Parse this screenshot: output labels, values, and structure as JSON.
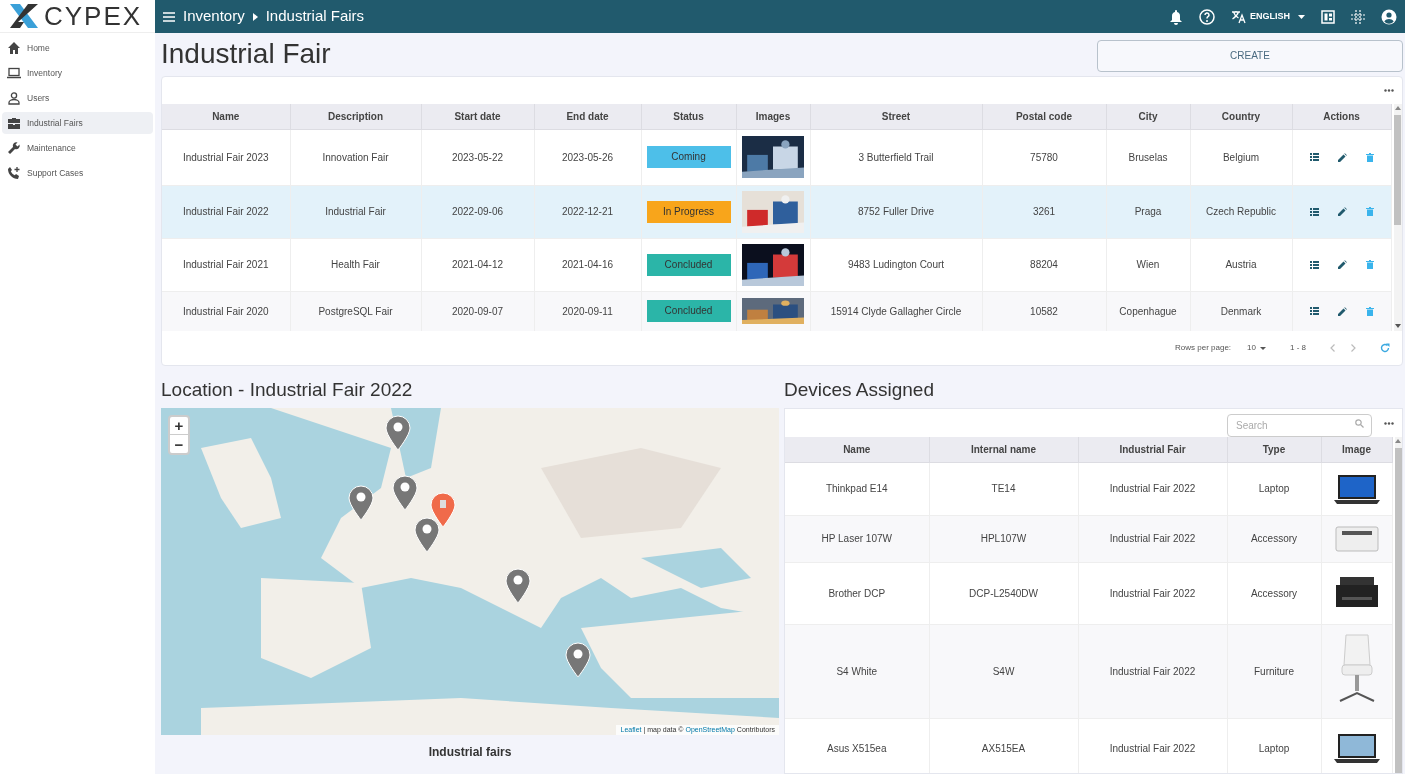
{
  "logo": {
    "text": "CYPEX"
  },
  "breadcrumb": [
    "Inventory",
    "Industrial Fairs"
  ],
  "topbar": {
    "language": "ENGLISH"
  },
  "sidebar": {
    "items": [
      {
        "label": "Home",
        "selected": false
      },
      {
        "label": "Inventory",
        "selected": false
      },
      {
        "label": "Users",
        "selected": false
      },
      {
        "label": "Industrial Fairs",
        "selected": true
      },
      {
        "label": "Maintenance",
        "selected": false
      },
      {
        "label": "Support Cases",
        "selected": false
      }
    ]
  },
  "page_title": "Industrial Fair",
  "create_button": "CREATE",
  "fairs_table": {
    "columns": [
      "Name",
      "Description",
      "Start date",
      "End date",
      "Status",
      "Images",
      "Street",
      "Postal code",
      "City",
      "Country",
      "Actions"
    ],
    "rows": [
      {
        "name": "Industrial Fair 2023",
        "description": "Innovation Fair",
        "start": "2023-05-22",
        "end": "2023-05-26",
        "status": {
          "text": "Coming",
          "color": "#4dbfe9"
        },
        "street": "3 Butterfield Trail",
        "postal": "75780",
        "city": "Bruselas",
        "country": "Belgium",
        "selected": false
      },
      {
        "name": "Industrial Fair 2022",
        "description": "Industrial Fair",
        "start": "2022-09-06",
        "end": "2022-12-21",
        "status": {
          "text": "In Progress",
          "color": "#f8a51b"
        },
        "street": "8752 Fuller Drive",
        "postal": "3261",
        "city": "Praga",
        "country": "Czech Republic",
        "selected": true
      },
      {
        "name": "Industrial Fair 2021",
        "description": "Health Fair",
        "start": "2021-04-12",
        "end": "2021-04-16",
        "status": {
          "text": "Concluded",
          "color": "#2bb5a8"
        },
        "street": "9483 Ludington Court",
        "postal": "88204",
        "city": "Wien",
        "country": "Austria",
        "selected": false
      },
      {
        "name": "Industrial Fair 2020",
        "description": "PostgreSQL Fair",
        "start": "2020-09-07",
        "end": "2020-09-11",
        "status": {
          "text": "Concluded",
          "color": "#2bb5a8"
        },
        "street": "15914 Clyde Gallagher Circle",
        "postal": "10582",
        "city": "Copenhague",
        "country": "Denmark",
        "selected": false
      }
    ],
    "pagination": {
      "rows_per_page_label": "Rows per page:",
      "rows_per_page": "10",
      "range": "1 - 8"
    }
  },
  "location": {
    "title": "Location - Industrial Fair 2022",
    "zoom_in": "+",
    "zoom_out": "−",
    "markers": [
      {
        "selected": false
      },
      {
        "selected": false
      },
      {
        "selected": false
      },
      {
        "selected": true
      },
      {
        "selected": false
      },
      {
        "selected": false
      },
      {
        "selected": false
      }
    ],
    "attribution": {
      "leaflet": "Leaflet",
      "middle": "| map data ©",
      "osm": "OpenStreetMap",
      "suffix": "Contributors"
    },
    "caption": "Industrial fairs"
  },
  "devices": {
    "title": "Devices Assigned",
    "search": {
      "placeholder": "Search"
    },
    "columns": [
      "Name",
      "Internal name",
      "Industrial Fair",
      "Type",
      "Image"
    ],
    "rows": [
      {
        "name": "Thinkpad E14",
        "internal": "TE14",
        "fair": "Industrial Fair 2022",
        "type": "Laptop"
      },
      {
        "name": "HP Laser 107W",
        "internal": "HPL107W",
        "fair": "Industrial Fair 2022",
        "type": "Accessory"
      },
      {
        "name": "Brother DCP",
        "internal": "DCP-L2540DW",
        "fair": "Industrial Fair 2022",
        "type": "Accessory"
      },
      {
        "name": "S4 White",
        "internal": "S4W",
        "fair": "Industrial Fair 2022",
        "type": "Furniture"
      },
      {
        "name": "Asus X515ea",
        "internal": "AX515EA",
        "fair": "Industrial Fair 2022",
        "type": "Laptop"
      }
    ]
  }
}
